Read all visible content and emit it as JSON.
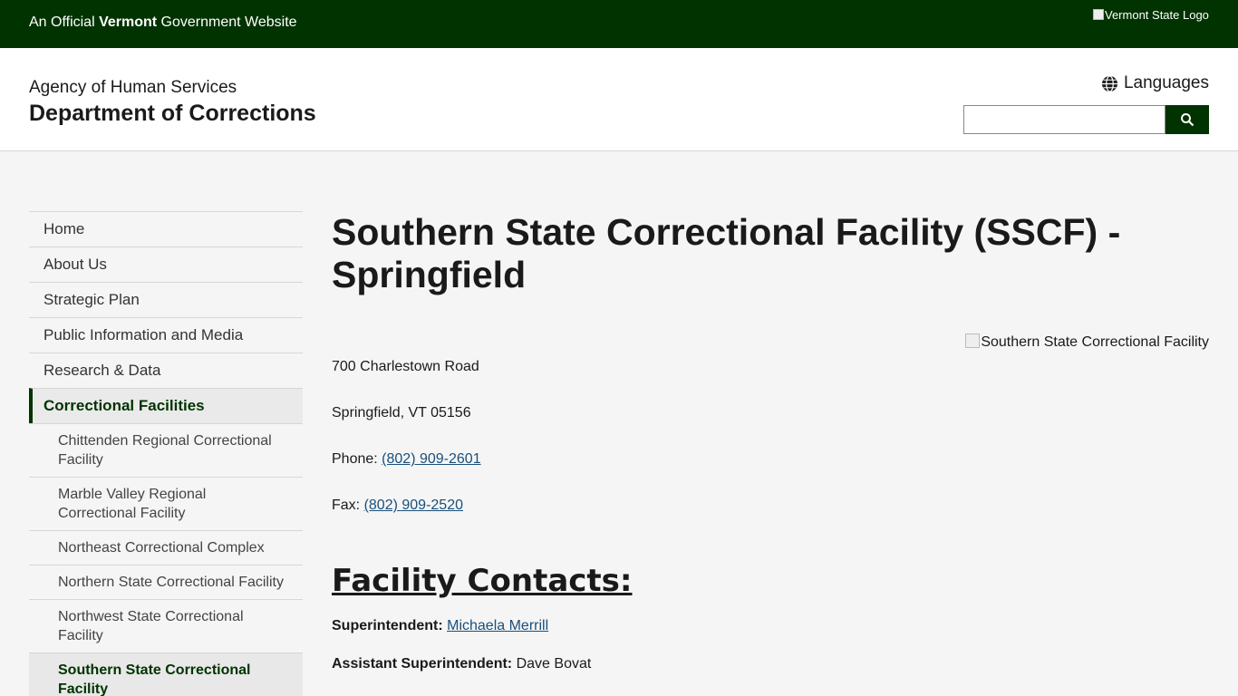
{
  "topbar": {
    "official_prefix": "An Official",
    "official_state": "Vermont",
    "official_suffix": "Government Website",
    "logo_alt": "Vermont State Logo"
  },
  "header": {
    "agency": "Agency of Human Services",
    "department": "Department of Corrections",
    "languages_label": "Languages",
    "search_placeholder": ""
  },
  "sidenav": {
    "items": [
      {
        "label": "Home"
      },
      {
        "label": "About Us"
      },
      {
        "label": "Strategic Plan"
      },
      {
        "label": "Public Information and Media"
      },
      {
        "label": "Research & Data"
      },
      {
        "label": "Correctional Facilities"
      }
    ],
    "subitems": [
      {
        "label": "Chittenden Regional Correctional Facility"
      },
      {
        "label": "Marble Valley Regional Correctional Facility"
      },
      {
        "label": "Northeast Correctional Complex"
      },
      {
        "label": "Northern State Correctional Facility"
      },
      {
        "label": "Northwest State Correctional Facility"
      },
      {
        "label": "Southern State Correctional Facility"
      }
    ]
  },
  "main": {
    "title": "Southern State Correctional Facility (SSCF) - Springfield",
    "image_alt": "Southern State Correctional Facility",
    "address_line1": "700 Charlestown Road",
    "address_line2": "Springfield, VT 05156",
    "phone_label": "Phone:",
    "phone": "(802) 909-2601",
    "fax_label": "Fax:",
    "fax": "(802) 909-2520",
    "contacts_heading": "Facility Contacts:",
    "superintendent_label": "Superintendent:",
    "superintendent": "Michaela Merrill",
    "asst_superintendent_label": "Assistant Superintendent:",
    "asst_superintendent": "Dave Bovat"
  },
  "colors": {
    "brand_green": "#003300",
    "link": "#1a4f7a"
  }
}
